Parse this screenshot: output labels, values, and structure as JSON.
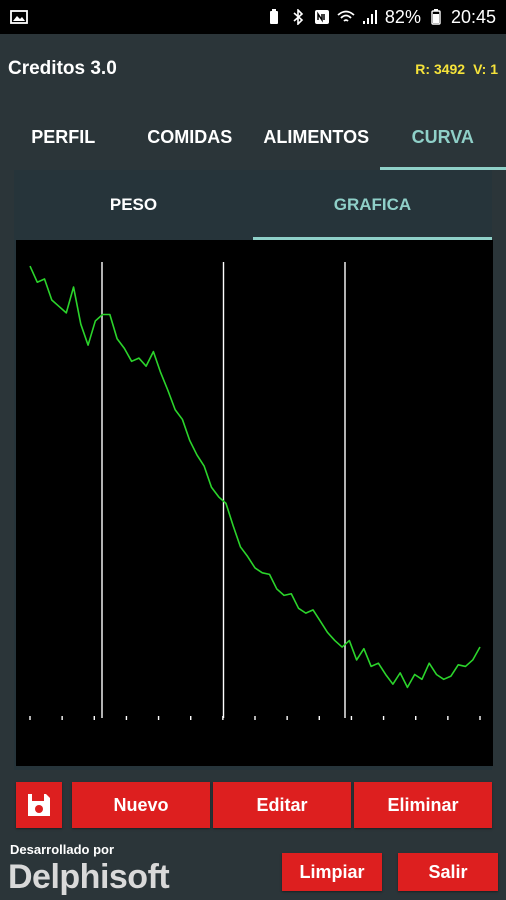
{
  "status_bar": {
    "battery": "82%",
    "time": "20:45"
  },
  "app_bar": {
    "title": "Creditos 3.0",
    "r_label": "R: 3492",
    "v_label": "V: 1"
  },
  "tabs": [
    {
      "label": "PERFIL"
    },
    {
      "label": "COMIDAS"
    },
    {
      "label": "ALIMENTOS"
    },
    {
      "label": "CURVA"
    }
  ],
  "subtabs": [
    {
      "label": "PESO"
    },
    {
      "label": "GRAFICA"
    }
  ],
  "chart_data": {
    "type": "line",
    "series": [
      {
        "color": "#2bd42b",
        "values": [
          99.5,
          98.5,
          98.7,
          97.4,
          97.0,
          96.6,
          98.2,
          95.9,
          94.6,
          96.1,
          96.5,
          96.5,
          95.0,
          94.4,
          93.6,
          93.8,
          93.3,
          94.2,
          92.9,
          91.8,
          90.6,
          90.0,
          88.7,
          87.8,
          87.1,
          85.8,
          85.2,
          84.8,
          83.4,
          82.1,
          81.5,
          80.8,
          80.5,
          80.4,
          79.5,
          79.1,
          79.2,
          78.3,
          78.0,
          78.2,
          77.5,
          76.8,
          76.3,
          75.9,
          76.3,
          75.1,
          75.8,
          74.7,
          74.9,
          74.2,
          73.6,
          74.3,
          73.4,
          74.2,
          73.9,
          74.9,
          74.2,
          73.9,
          74.1,
          74.8,
          74.7,
          75.1,
          75.9
        ]
      }
    ],
    "vertical_lines": [
      0.16,
      0.43,
      0.7
    ],
    "ylim": [
      72,
      100
    ],
    "axis_color": "#ffffff",
    "background": "#000000"
  },
  "buttons": {
    "save_icon": "floppy-disk-icon",
    "nuevo": "Nuevo",
    "editar": "Editar",
    "eliminar": "Eliminar",
    "limpiar": "Limpiar",
    "salir": "Salir"
  },
  "footer": {
    "developed_by": "Desarrollado por",
    "brand": "Delphisoft"
  }
}
